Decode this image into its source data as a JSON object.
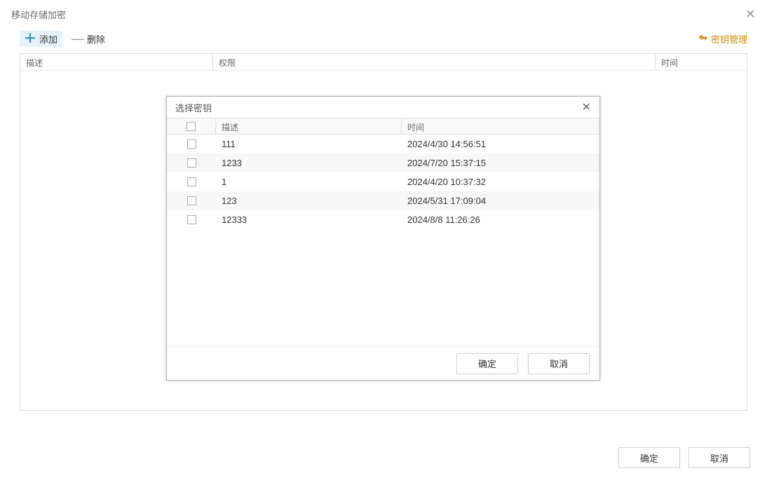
{
  "window": {
    "title": "移动存储加密"
  },
  "toolbar": {
    "add_label": "添加",
    "delete_label": "删除",
    "key_mgmt_label": "密钥管理"
  },
  "main_table": {
    "headers": {
      "description": "描述",
      "permission": "权限",
      "time": "时间"
    }
  },
  "inner_dialog": {
    "title": "选择密钥",
    "headers": {
      "description": "描述",
      "time": "时间"
    },
    "rows": [
      {
        "desc": "111",
        "time": "2024/4/30 14:56:51"
      },
      {
        "desc": "1233",
        "time": "2024/7/20 15:37:15"
      },
      {
        "desc": "1",
        "time": "2024/4/20 10:37:32"
      },
      {
        "desc": "123",
        "time": "2024/5/31 17:09:04"
      },
      {
        "desc": "12333",
        "time": "2024/8/8 11:26:26"
      }
    ],
    "buttons": {
      "ok": "确定",
      "cancel": "取消"
    }
  },
  "footer": {
    "ok": "确定",
    "cancel": "取消"
  }
}
